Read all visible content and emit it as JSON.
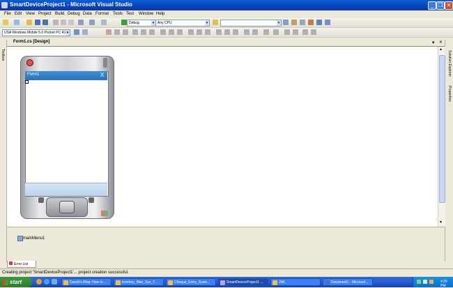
{
  "window": {
    "title": "SmartDeviceProject1 - Microsoft Visual Studio",
    "minimize_glyph": "_",
    "restore_glyph": "❐",
    "close_glyph": "✕"
  },
  "menu": [
    "File",
    "Edit",
    "View",
    "Project",
    "Build",
    "Debug",
    "Data",
    "Format",
    "Tools",
    "Test",
    "Window",
    "Help"
  ],
  "toolbar": {
    "config": "Debug",
    "platform": "Any CPU",
    "device": "USA Windows Mobile 5.0 Pocket PC R2"
  },
  "left_strip": {
    "toolbox_label": "Toolbox"
  },
  "right_strip": {
    "solution_explorer": "Solution Explorer",
    "properties": "Properties"
  },
  "document": {
    "tab": "Form1.cs [Design]",
    "dropdown_glyph": "▾",
    "close_glyph": "✕"
  },
  "form": {
    "title": "Form1",
    "close_glyph": "X"
  },
  "tray": {
    "component": "mainMenu1"
  },
  "bottom": {
    "error_tab": "Error List"
  },
  "status": {
    "text": "Creating project 'SmartDeviceProject1'... project creation successful."
  },
  "taskbar": {
    "start": "start",
    "tasks": [
      {
        "label": "Darshi's Blog: How to ..."
      },
      {
        "label": "Invetory_Man_Sys_T..."
      },
      {
        "label": "Cheque_Entry_Syste..."
      },
      {
        "label": "SmartDeviceProject1 ..."
      },
      {
        "label": "JWL"
      },
      {
        "label": "Document1 - Microsof..."
      }
    ],
    "clock": "4:26 PM"
  },
  "colors": {
    "titlebar": "#0a5fd8",
    "taskbar": "#245edb",
    "start": "#3c9a3c",
    "form_caption": "#3d8fd8"
  }
}
